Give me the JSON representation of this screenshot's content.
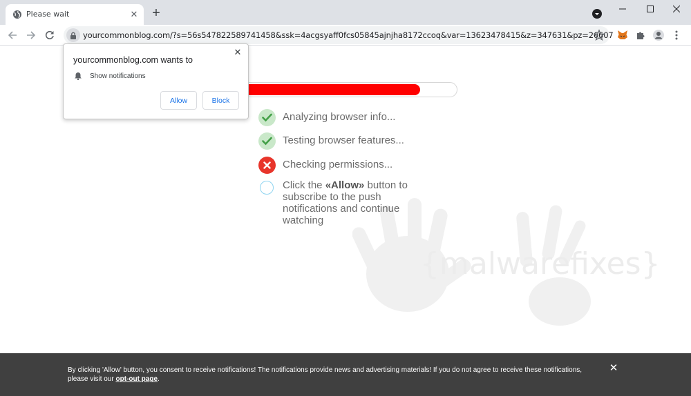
{
  "browser": {
    "tab_title": "Please wait",
    "new_tab_symbol": "+",
    "tab_close_symbol": "✕",
    "url": "yourcommonblog.com/?s=56s547822589741458&ssk=4acgsyaff0fcs05845ajnjha8172ccoq&var=13623478415&z=347631&pz=26607"
  },
  "permission_popup": {
    "title": "yourcommonblog.com wants to",
    "permission": "Show notifications",
    "allow_label": "Allow",
    "block_label": "Block",
    "close_symbol": "✕"
  },
  "page": {
    "progress": 0.85,
    "progress_color": "#ff0000",
    "steps": [
      {
        "text": "Analyzing browser info...",
        "status": "done"
      },
      {
        "text": "Testing browser features...",
        "status": "done"
      },
      {
        "text": "Checking permissions...",
        "status": "failed"
      },
      {
        "text_before": "Click the ",
        "text_strong": "«Allow»",
        "text_after": " button to subscribe to the push notifications and continue watching",
        "status": "pending"
      }
    ],
    "watermark": "{malwarefixes}"
  },
  "bottom_bar": {
    "text": "By clicking 'Allow' button, you consent to receive notifications! The notifications provide news and advertising materials! If you do not agree to receive these notifications, please visit our ",
    "link_text": "opt-out page",
    "after_link": ".",
    "close_symbol": "✕"
  },
  "colors": {
    "success": "#4caf50",
    "error": "#e8352b",
    "link": "#1a73e8"
  }
}
